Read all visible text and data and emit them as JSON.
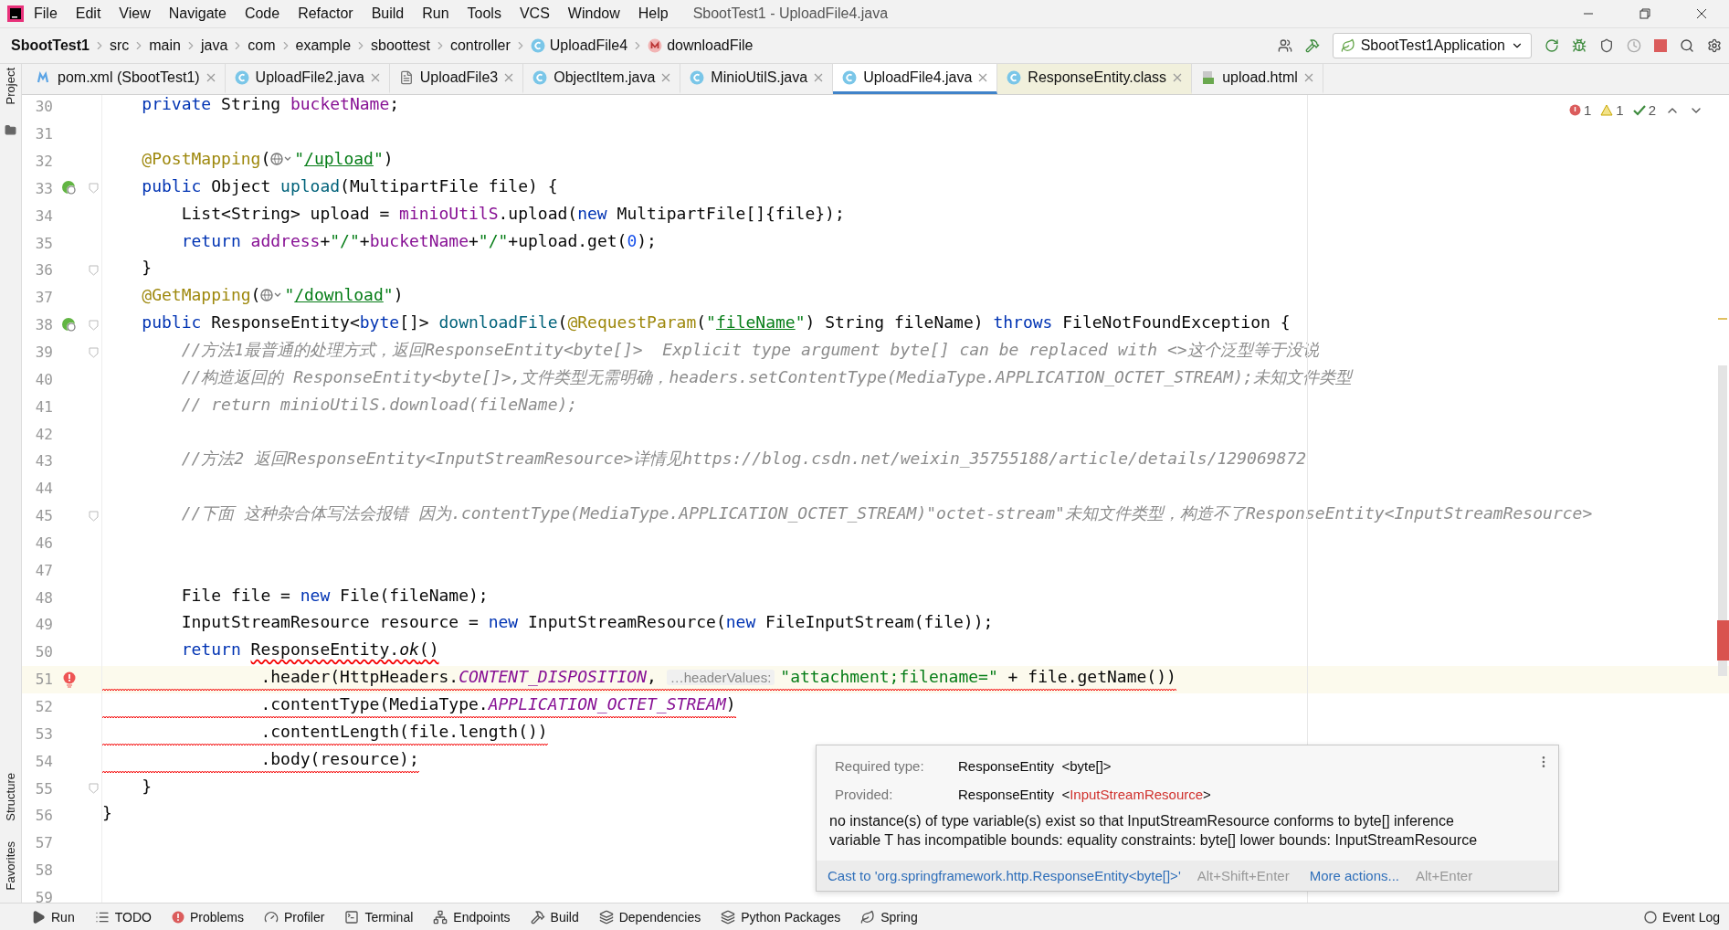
{
  "window": {
    "title": "SbootTest1 - UploadFile4.java"
  },
  "menu": [
    "File",
    "Edit",
    "View",
    "Navigate",
    "Code",
    "Refactor",
    "Build",
    "Run",
    "Tools",
    "VCS",
    "Window",
    "Help"
  ],
  "breadcrumbs": [
    {
      "kind": "project",
      "label": "SbootTest1"
    },
    {
      "kind": "folder",
      "label": "src"
    },
    {
      "kind": "folder",
      "label": "main"
    },
    {
      "kind": "folder",
      "label": "java"
    },
    {
      "kind": "folder",
      "label": "com"
    },
    {
      "kind": "folder",
      "label": "example"
    },
    {
      "kind": "folder",
      "label": "sboottest"
    },
    {
      "kind": "folder",
      "label": "controller"
    },
    {
      "kind": "class",
      "label": "UploadFile4"
    },
    {
      "kind": "method",
      "label": "downloadFile"
    }
  ],
  "run_config": {
    "label": "SbootTest1Application"
  },
  "tabs": [
    {
      "kind": "maven",
      "label": "pom.xml (SbootTest1)",
      "selected": false
    },
    {
      "kind": "class",
      "label": "UploadFile2.java",
      "selected": false
    },
    {
      "kind": "file",
      "label": "UploadFile3",
      "selected": false
    },
    {
      "kind": "class",
      "label": "ObjectItem.java",
      "selected": false
    },
    {
      "kind": "class",
      "label": "MinioUtilS.java",
      "selected": false
    },
    {
      "kind": "class",
      "label": "UploadFile4.java",
      "selected": true
    },
    {
      "kind": "library",
      "label": "ResponseEntity.class",
      "selected": false
    },
    {
      "kind": "html",
      "label": "upload.html",
      "selected": false
    }
  ],
  "side_tools_top": [
    "Project"
  ],
  "side_tools_bottom": [
    "Structure",
    "Favorites"
  ],
  "inspections": {
    "errors": "1",
    "warnings": "1",
    "passed": "2"
  },
  "lines": [
    {
      "kind": "code",
      "number": "30",
      "current": false,
      "error": false,
      "tokens": [
        {
          "kind": "kw",
          "text": "    private"
        },
        {
          "kind": "plain",
          "text": " String "
        },
        {
          "kind": "field",
          "text": "bucketName"
        },
        {
          "kind": "plain",
          "text": ";"
        }
      ]
    },
    {
      "kind": "code",
      "number": "31",
      "current": false
    },
    {
      "kind": "code",
      "number": "32",
      "current": false,
      "error": false,
      "tokens": [
        {
          "kind": "ann",
          "text": "    @PostMapping"
        },
        {
          "kind": "plain",
          "text": "("
        },
        {
          "kind": "globe"
        },
        {
          "kind": "str",
          "text": "\""
        },
        {
          "kind": "link",
          "text": "/upload"
        },
        {
          "kind": "str",
          "text": "\""
        },
        {
          "kind": "plain",
          "text": ")"
        }
      ]
    },
    {
      "kind": "endpoint",
      "number": "33",
      "current": false,
      "error": false,
      "fold": true,
      "tokens": [
        {
          "kind": "kw",
          "text": "    public"
        },
        {
          "kind": "plain",
          "text": " Object "
        },
        {
          "kind": "decl",
          "text": "upload"
        },
        {
          "kind": "plain",
          "text": "(MultipartFile file) {"
        }
      ]
    },
    {
      "kind": "code",
      "number": "34",
      "current": false,
      "error": false,
      "tokens": [
        {
          "kind": "plain",
          "text": "        List<String> upload = "
        },
        {
          "kind": "field",
          "text": "minioUtilS"
        },
        {
          "kind": "plain",
          "text": ".upload("
        },
        {
          "kind": "kw",
          "text": "new"
        },
        {
          "kind": "plain",
          "text": " MultipartFile[]{file});"
        }
      ]
    },
    {
      "kind": "code",
      "number": "35",
      "current": false,
      "error": false,
      "tokens": [
        {
          "kind": "kw",
          "text": "        return"
        },
        {
          "kind": "field",
          "text": " address"
        },
        {
          "kind": "plain",
          "text": "+"
        },
        {
          "kind": "str",
          "text": "\"/\""
        },
        {
          "kind": "plain",
          "text": "+"
        },
        {
          "kind": "field",
          "text": "bucketName"
        },
        {
          "kind": "plain",
          "text": "+"
        },
        {
          "kind": "str",
          "text": "\"/\""
        },
        {
          "kind": "plain",
          "text": "+upload.get("
        },
        {
          "kind": "num",
          "text": "0"
        },
        {
          "kind": "plain",
          "text": ");"
        }
      ]
    },
    {
      "kind": "code",
      "number": "36",
      "current": false,
      "error": false,
      "fold": true,
      "tokens": [
        {
          "kind": "plain",
          "text": "    }"
        }
      ]
    },
    {
      "kind": "code",
      "number": "37",
      "current": false,
      "error": false,
      "tokens": [
        {
          "kind": "ann",
          "text": "    @GetMapping"
        },
        {
          "kind": "plain",
          "text": "("
        },
        {
          "kind": "globe"
        },
        {
          "kind": "str",
          "text": "\""
        },
        {
          "kind": "link",
          "text": "/download"
        },
        {
          "kind": "str",
          "text": "\""
        },
        {
          "kind": "plain",
          "text": ")"
        }
      ]
    },
    {
      "kind": "endpoint",
      "number": "38",
      "current": false,
      "error": false,
      "fold": true,
      "tokens": [
        {
          "kind": "kw",
          "text": "    public"
        },
        {
          "kind": "plain",
          "text": " ResponseEntity<"
        },
        {
          "kind": "kw",
          "text": "byte"
        },
        {
          "kind": "plain",
          "text": "[]> "
        },
        {
          "kind": "decl",
          "text": "downloadFile"
        },
        {
          "kind": "plain",
          "text": "("
        },
        {
          "kind": "ann",
          "text": "@RequestParam"
        },
        {
          "kind": "plain",
          "text": "("
        },
        {
          "kind": "str",
          "text": "\""
        },
        {
          "kind": "link",
          "text": "fileName"
        },
        {
          "kind": "str",
          "text": "\""
        },
        {
          "kind": "plain",
          "text": ") String fileName) "
        },
        {
          "kind": "kw",
          "text": "throws"
        },
        {
          "kind": "plain",
          "text": " FileNotFoundException {"
        }
      ]
    },
    {
      "kind": "code",
      "number": "39",
      "current": false,
      "error": false,
      "fold": true,
      "tokens": [
        {
          "kind": "cmt",
          "text": "        //方法1最普通的处理方式，返回ResponseEntity<byte[]>  Explicit type argument byte[] can be replaced with <>这个泛型等于没说"
        }
      ]
    },
    {
      "kind": "code",
      "number": "40",
      "current": false,
      "error": false,
      "tokens": [
        {
          "kind": "cmt",
          "text": "        //构造返回的 ResponseEntity<byte[]>,文件类型无需明确，headers.setContentType(MediaType.APPLICATION_OCTET_STREAM);未知文件类型"
        }
      ]
    },
    {
      "kind": "code",
      "number": "41",
      "current": false,
      "error": false,
      "tokens": [
        {
          "kind": "cmt",
          "text": "        // return minioUtilS.download(fileName);"
        }
      ]
    },
    {
      "kind": "code",
      "number": "42",
      "current": false
    },
    {
      "kind": "code",
      "number": "43",
      "current": false,
      "error": false,
      "tokens": [
        {
          "kind": "cmt",
          "text": "        //方法2 返回ResponseEntity<InputStreamResource>详情见https://blog.csdn.net/weixin_35755188/article/details/129069872"
        }
      ]
    },
    {
      "kind": "code",
      "number": "44",
      "current": false
    },
    {
      "kind": "code",
      "number": "45",
      "current": false,
      "error": false,
      "fold": true,
      "tokens": [
        {
          "kind": "cmt",
          "text": "        //下面 这种杂合体写法会报错 因为.contentType(MediaType.APPLICATION_OCTET_STREAM)\"octet-stream\"未知文件类型，构造不了ResponseEntity<InputStreamResource>"
        }
      ]
    },
    {
      "kind": "code",
      "number": "46",
      "current": false
    },
    {
      "kind": "code",
      "number": "47",
      "current": false
    },
    {
      "kind": "code",
      "number": "48",
      "current": false,
      "error": false,
      "tokens": [
        {
          "kind": "plain",
          "text": "        File file = "
        },
        {
          "kind": "kw",
          "text": "new"
        },
        {
          "kind": "plain",
          "text": " File(fileName);"
        }
      ]
    },
    {
      "kind": "code",
      "number": "49",
      "current": false,
      "error": false,
      "tokens": [
        {
          "kind": "plain",
          "text": "        InputStreamResource resource = "
        },
        {
          "kind": "kw",
          "text": "new"
        },
        {
          "kind": "plain",
          "text": " InputStreamResource("
        },
        {
          "kind": "kw",
          "text": "new"
        },
        {
          "kind": "plain",
          "text": " FileInputStream(file));"
        }
      ]
    },
    {
      "kind": "code",
      "number": "50",
      "current": false,
      "error": false,
      "tokens": [
        {
          "kind": "kw",
          "text": "        return "
        },
        {
          "kind": "plain",
          "text": "ResponseEntity.",
          "error": true
        },
        {
          "kind": "italic",
          "text": "ok",
          "error": true
        },
        {
          "kind": "plain",
          "text": "()",
          "error": true
        }
      ]
    },
    {
      "kind": "error",
      "number": "51",
      "current": true,
      "error": true,
      "tokens": [
        {
          "kind": "plain",
          "text": "                .header(HttpHeaders."
        },
        {
          "kind": "static",
          "text": "CONTENT_DISPOSITION"
        },
        {
          "kind": "plain",
          "text": ", "
        },
        {
          "kind": "hint",
          "text": "…headerValues:"
        },
        {
          "kind": "str",
          "text": "\"attachment;filename=\""
        },
        {
          "kind": "plain",
          "text": " + file.getName())"
        }
      ]
    },
    {
      "kind": "code",
      "number": "52",
      "current": false,
      "error": true,
      "tokens": [
        {
          "kind": "plain",
          "text": "                .contentType(MediaType."
        },
        {
          "kind": "static",
          "text": "APPLICATION_OCTET_STREAM"
        },
        {
          "kind": "plain",
          "text": ")"
        }
      ]
    },
    {
      "kind": "code",
      "number": "53",
      "current": false,
      "error": true,
      "tokens": [
        {
          "kind": "plain",
          "text": "                .contentLength(file.length())"
        }
      ]
    },
    {
      "kind": "code",
      "number": "54",
      "current": false,
      "error": true,
      "tokens": [
        {
          "kind": "plain",
          "text": "                .body(resource);"
        }
      ]
    },
    {
      "kind": "code",
      "number": "55",
      "current": false,
      "error": false,
      "fold": true,
      "tokens": [
        {
          "kind": "plain",
          "text": "    }"
        }
      ]
    },
    {
      "kind": "code",
      "number": "56",
      "current": false,
      "error": false,
      "tokens": [
        {
          "kind": "plain",
          "text": "}"
        }
      ]
    },
    {
      "kind": "code",
      "number": "57",
      "current": false
    },
    {
      "kind": "code",
      "number": "58",
      "current": false
    },
    {
      "kind": "code",
      "number": "59",
      "current": false
    }
  ],
  "popup": {
    "rows": [
      {
        "label": "Required type:",
        "tokens": [
          {
            "kind": "plain",
            "text": "ResponseEntity"
          },
          {
            "kind": "plain",
            "text": "  <byte[]>"
          }
        ]
      },
      {
        "label": "Provided:",
        "tokens": [
          {
            "kind": "plain",
            "text": "ResponseEntity"
          },
          {
            "kind": "plain",
            "text": "  <"
          },
          {
            "kind": "bad",
            "text": "InputStreamResource"
          },
          {
            "kind": "plain",
            "text": ">"
          }
        ]
      }
    ],
    "message": "no instance(s) of type variable(s) exist so that InputStreamResource conforms to byte[] inference variable T has incompatible bounds: equality constraints: byte[] lower bounds: InputStreamResource",
    "actions": [
      {
        "label": "Cast to 'org.springframework.http.ResponseEntity<byte[]>'",
        "shortcut": "Alt+Shift+Enter"
      },
      {
        "label": "More actions...",
        "shortcut": "Alt+Enter"
      }
    ]
  },
  "bottom_tools": [
    {
      "kind": "run",
      "label": "Run"
    },
    {
      "kind": "todo",
      "label": "TODO"
    },
    {
      "kind": "problems",
      "label": "Problems"
    },
    {
      "kind": "profiler",
      "label": "Profiler"
    },
    {
      "kind": "terminal",
      "label": "Terminal"
    },
    {
      "kind": "endpoints",
      "label": "Endpoints"
    },
    {
      "kind": "build",
      "label": "Build"
    },
    {
      "kind": "dependencies",
      "label": "Dependencies"
    },
    {
      "kind": "python",
      "label": "Python Packages"
    },
    {
      "kind": "spring",
      "label": "Spring"
    }
  ],
  "event_log": {
    "label": "Event Log"
  }
}
